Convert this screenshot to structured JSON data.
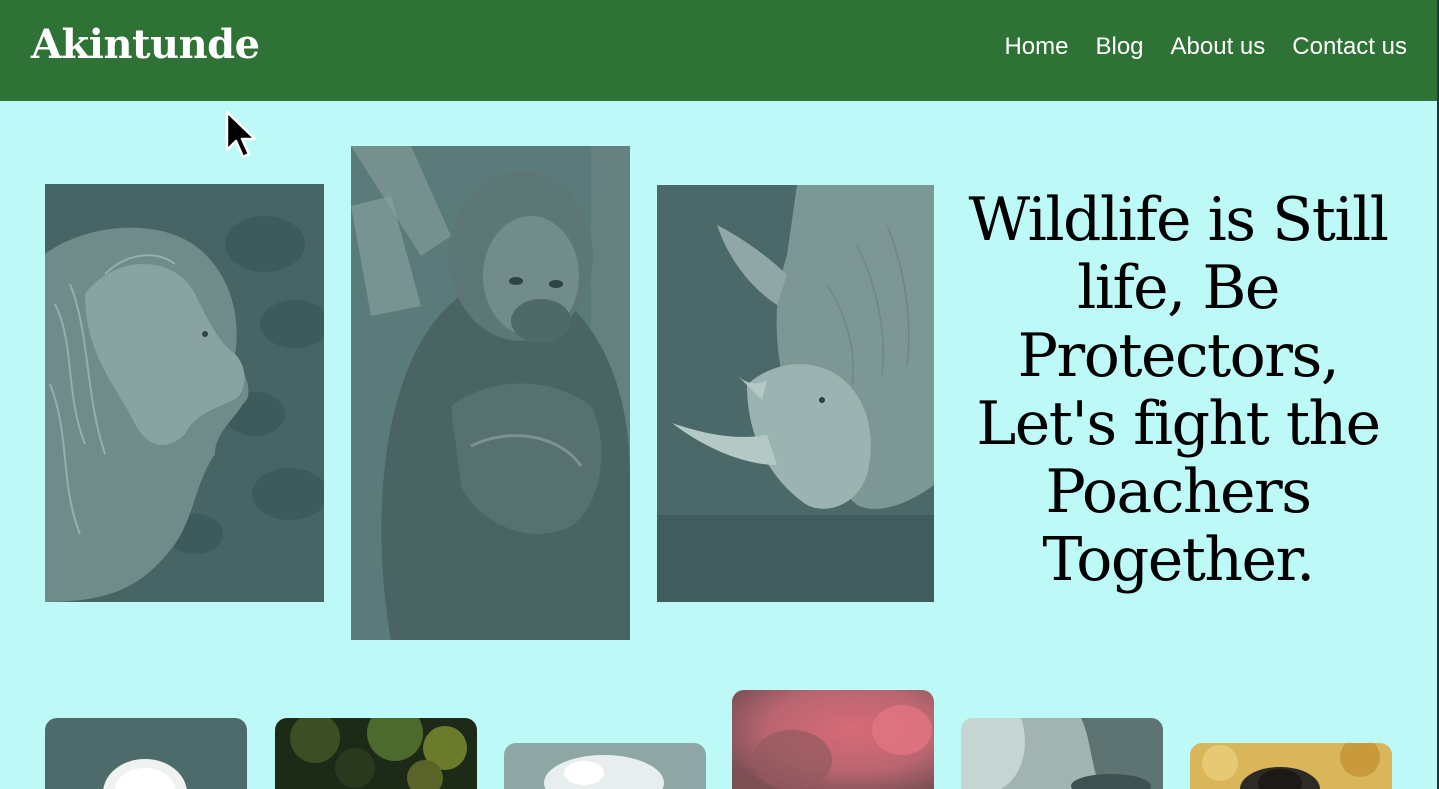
{
  "header": {
    "brand": "Akintunde",
    "nav": [
      "Home",
      "Blog",
      "About us",
      "Contact us"
    ]
  },
  "hero": {
    "tagline": "Wildlife is Still life, Be Protectors, Let's fight the Poachers Together.",
    "images": [
      "lion-photo",
      "gorilla-photo",
      "rhino-photo"
    ]
  },
  "gallery": {
    "images": [
      "eagle-photo",
      "forest-photo",
      "sheep-photo",
      "flamingo-photo",
      "elephant-photo",
      "monkey-photo"
    ]
  },
  "colors": {
    "header_bg": "#2f7236",
    "page_bg": "#bdfaf7",
    "photo_tint": "#4d6c6c"
  }
}
